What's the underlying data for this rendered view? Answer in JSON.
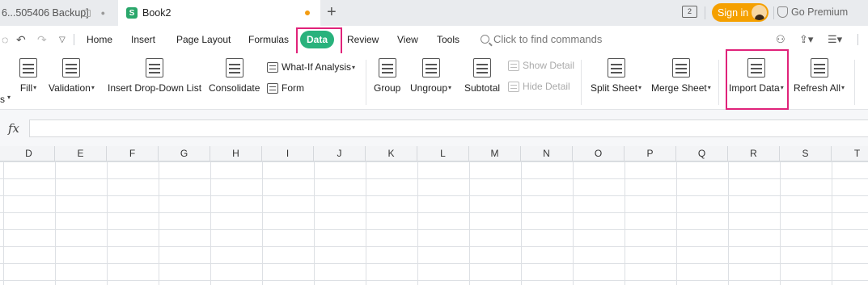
{
  "tabs": {
    "backup_title": "6...505406 Backup]",
    "active_title": "Book2",
    "new_tab": "+"
  },
  "titlebar": {
    "layout_badge": "2",
    "signin_label": "Sign in",
    "premium_label": "Go Premium"
  },
  "menu": {
    "items": [
      "Home",
      "Insert",
      "Page Layout",
      "Formulas",
      "Data",
      "Review",
      "View",
      "Tools"
    ],
    "active": "Data",
    "search_placeholder": "Click to find commands"
  },
  "ribbon": {
    "fill": "Fill",
    "validation": "Validation",
    "dropdown_list": "Insert Drop-Down List",
    "consolidate": "Consolidate",
    "whatif": "What-If Analysis",
    "form": "Form",
    "group": "Group",
    "ungroup": "Ungroup",
    "subtotal": "Subtotal",
    "show_detail": "Show Detail",
    "hide_detail": "Hide Detail",
    "split_sheet": "Split Sheet",
    "merge_sheet": "Merge Sheet",
    "import_data": "Import Data",
    "refresh_all": "Refresh All",
    "left_fragment": "s"
  },
  "formula": {
    "fx_label": "fx",
    "value": ""
  },
  "columns": [
    "D",
    "E",
    "F",
    "G",
    "H",
    "I",
    "J",
    "K",
    "L",
    "M",
    "N",
    "O",
    "P",
    "Q",
    "R",
    "S",
    "T"
  ],
  "colors": {
    "accent_green": "#29b27c",
    "highlight_pink": "#e0237a",
    "signin_orange": "#f5a000"
  }
}
